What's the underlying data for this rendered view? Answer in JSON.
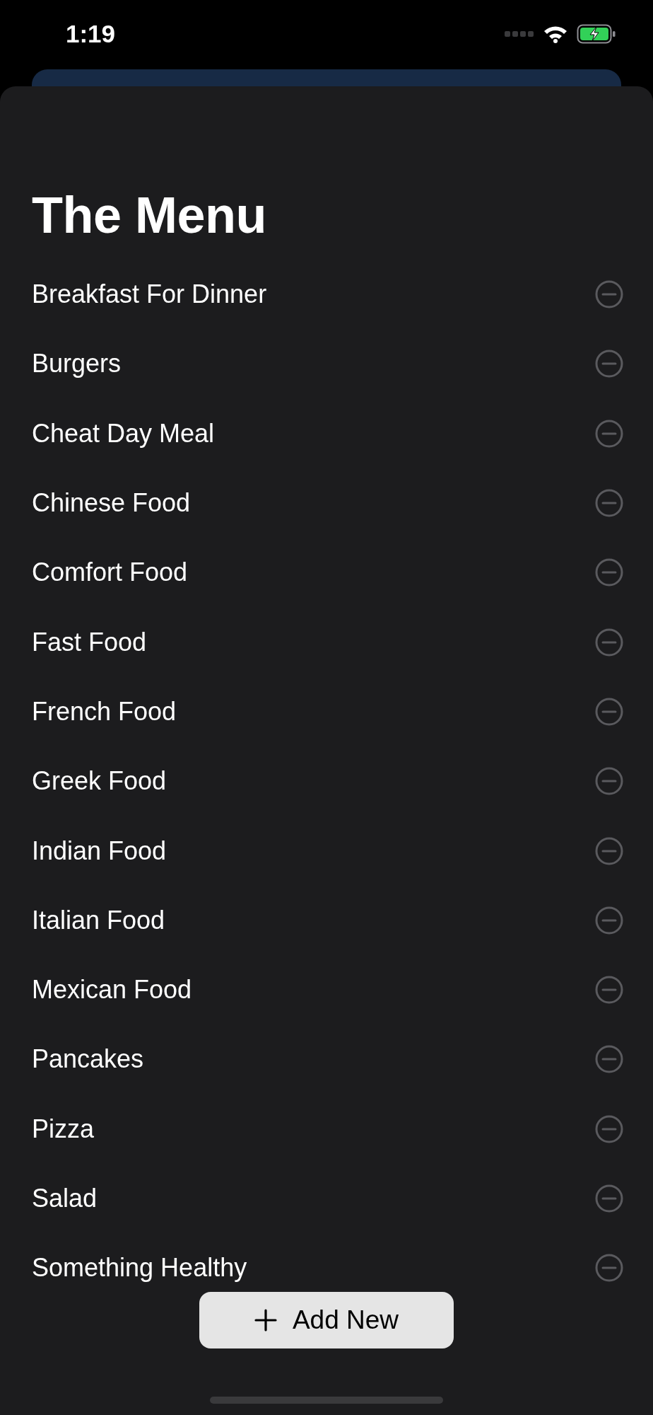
{
  "status_bar": {
    "time": "1:19"
  },
  "title": "The Menu",
  "items": [
    {
      "name": "Breakfast For Dinner"
    },
    {
      "name": "Burgers"
    },
    {
      "name": "Cheat Day Meal"
    },
    {
      "name": "Chinese Food"
    },
    {
      "name": "Comfort Food"
    },
    {
      "name": "Fast Food"
    },
    {
      "name": "French Food"
    },
    {
      "name": "Greek Food"
    },
    {
      "name": "Indian Food"
    },
    {
      "name": "Italian Food"
    },
    {
      "name": "Mexican Food"
    },
    {
      "name": "Pancakes"
    },
    {
      "name": "Pizza"
    },
    {
      "name": "Salad"
    },
    {
      "name": "Something Healthy"
    }
  ],
  "add_button": {
    "label": "Add New"
  }
}
